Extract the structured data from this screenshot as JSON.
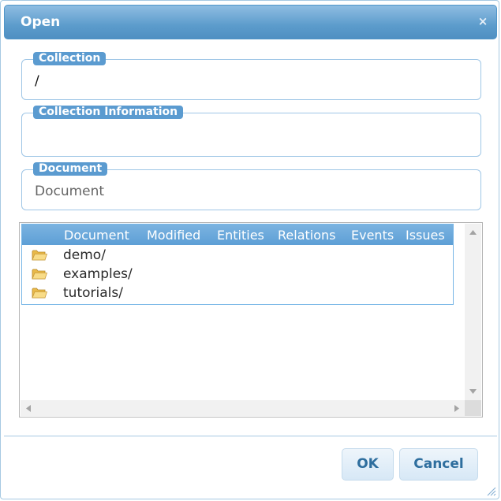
{
  "dialog": {
    "title": "Open",
    "close_icon": "close-icon",
    "close_glyph": "×"
  },
  "collection": {
    "legend": "Collection",
    "value": "/"
  },
  "collection_info": {
    "legend": "Collection Information",
    "value": ""
  },
  "document": {
    "legend": "Document",
    "value": "Document"
  },
  "file_list": {
    "columns": [
      "Document",
      "Modified",
      "Entities",
      "Relations",
      "Events",
      "Issues"
    ],
    "rows": [
      {
        "icon": "folder-icon",
        "label": "demo/"
      },
      {
        "icon": "folder-icon",
        "label": "examples/"
      },
      {
        "icon": "folder-icon",
        "label": "tutorials/"
      }
    ]
  },
  "buttons": {
    "ok_label": "OK",
    "cancel_label": "Cancel"
  },
  "colors": {
    "accent": "#5c9ccc",
    "button_text": "#2e6e9e",
    "border": "#a6c9e2"
  }
}
